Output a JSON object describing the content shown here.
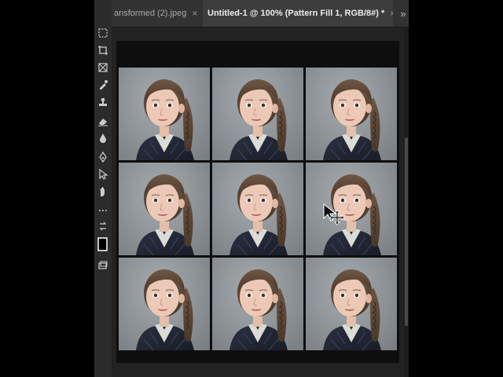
{
  "tabs": [
    {
      "label": "ansformed (2).jpeg",
      "close": "×",
      "active": false
    },
    {
      "label": "Untitled-1 @ 100% (Pattern Fill 1, RGB/8#) *",
      "close": "×",
      "active": true
    }
  ],
  "overflow_icon": "»",
  "tools": [
    "marquee-icon",
    "crop-icon",
    "frame-icon",
    "eyedropper-icon",
    "stamp-icon",
    "eraser-icon",
    "blur-icon",
    "pen-icon",
    "path-select-icon",
    "hand-icon",
    "more-tools-icon",
    "swap-colors-icon",
    "color-swatch-icon",
    "screen-mode-icon"
  ],
  "grid": {
    "rows": 3,
    "cols": 3,
    "content": "portrait of a girl with braids"
  },
  "colors": {
    "toolbar": "#2b2b2b",
    "tabbar": "#323232",
    "active_tab": "#3d3d3d",
    "canvas": "#222222"
  }
}
